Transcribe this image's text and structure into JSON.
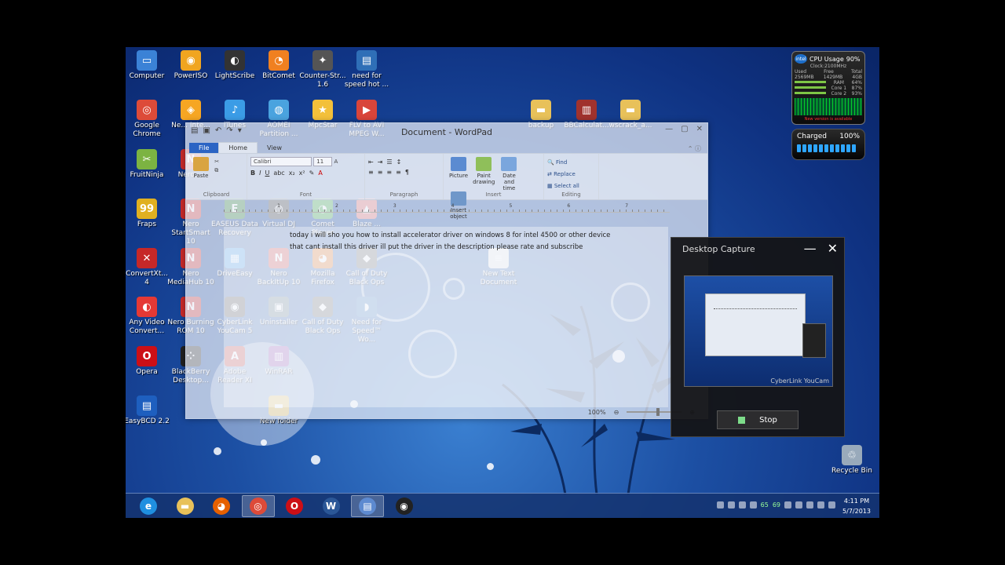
{
  "desktop_icons": [
    {
      "label": "Computer",
      "color": "#3b82d6",
      "glyph": "▭"
    },
    {
      "label": "PowerISO",
      "color": "#f0a520",
      "glyph": "◉"
    },
    {
      "label": "LightScribe",
      "color": "#333333",
      "glyph": "◐"
    },
    {
      "label": "BitComet",
      "color": "#f08020",
      "glyph": "◔"
    },
    {
      "label": "Counter-Str... 1.6",
      "color": "#555555",
      "glyph": "✦"
    },
    {
      "label": "need for speed hot ...",
      "color": "#2f6fb7",
      "glyph": "▤"
    },
    {
      "label": "Google Chrome",
      "color": "#dd4b39",
      "glyph": "◎"
    },
    {
      "label": "Ne... Inte...",
      "color": "#f6a623",
      "glyph": "◈"
    },
    {
      "label": "iTunes",
      "color": "#3b9ce6",
      "glyph": "♪"
    },
    {
      "label": "AOMEI Partition ...",
      "color": "#4aa3df",
      "glyph": "◍"
    },
    {
      "label": "MpcStar",
      "color": "#f3c03a",
      "glyph": "★"
    },
    {
      "label": "FLV to AVI MPEG W...",
      "color": "#d9453a",
      "glyph": "▶"
    },
    {
      "label": "FruitNinja",
      "color": "#7cb342",
      "glyph": "✂"
    },
    {
      "label": "Nero ...",
      "color": "#cc2b2b",
      "glyph": "N"
    },
    {
      "label": "Fraps",
      "color": "#e0b020",
      "glyph": "99"
    },
    {
      "label": "Nero StartSmart 10",
      "color": "#cc2b2b",
      "glyph": "N"
    },
    {
      "label": "EASEUS Data Recovery",
      "color": "#2e7d32",
      "glyph": "E"
    },
    {
      "label": "Virtual DJ",
      "color": "#444444",
      "glyph": "◍"
    },
    {
      "label": "Comet Player",
      "color": "#4caf50",
      "glyph": "◔"
    },
    {
      "label": "Blaze ...",
      "color": "#e57373",
      "glyph": "▲"
    },
    {
      "label": "ConvertXt... 4",
      "color": "#c62828",
      "glyph": "✕"
    },
    {
      "label": "Nero MediaHub 10",
      "color": "#cc2b2b",
      "glyph": "N"
    },
    {
      "label": "DriveEasy",
      "color": "#1e88e5",
      "glyph": "▦"
    },
    {
      "label": "Nero BackItUp 10",
      "color": "#cc2b2b",
      "glyph": "N"
    },
    {
      "label": "Mozilla Firefox",
      "color": "#e66000",
      "glyph": "◕"
    },
    {
      "label": "Call of Duty Black Ops",
      "color": "#555555",
      "glyph": "◆"
    },
    {
      "label": "New Text Document",
      "color": "#eeeeee",
      "glyph": "≡"
    },
    {
      "label": "Any Video Convert...",
      "color": "#e53935",
      "glyph": "◐"
    },
    {
      "label": "Nero Burning ROM 10",
      "color": "#cc2b2b",
      "glyph": "N"
    },
    {
      "label": "CyberLink YouCam 5",
      "color": "#333333",
      "glyph": "◉"
    },
    {
      "label": "Uninstaller",
      "color": "#546e7a",
      "glyph": "▣"
    },
    {
      "label": "Call of Duty Black Ops",
      "color": "#555555",
      "glyph": "◆"
    },
    {
      "label": "Need for Speed™ Wo...",
      "color": "#2f6fb7",
      "glyph": "◗"
    },
    {
      "label": "Opera",
      "color": "#cc0f16",
      "glyph": "O"
    },
    {
      "label": "BlackBerry Desktop...",
      "color": "#222222",
      "glyph": "⁘"
    },
    {
      "label": "Adobe Reader XI",
      "color": "#c62828",
      "glyph": "A"
    },
    {
      "label": "WinRAR",
      "color": "#8d3ea8",
      "glyph": "▥"
    },
    {
      "label": "EasyBCD 2.2",
      "color": "#1e5fbf",
      "glyph": "▤"
    },
    {
      "label": "New folder",
      "color": "#e8c15a",
      "glyph": "▬"
    },
    {
      "label": "backup",
      "color": "#e8c15a",
      "glyph": "▬"
    },
    {
      "label": "BBCalculat...",
      "color": "#a0322d",
      "glyph": "▥"
    },
    {
      "label": "wscrack_a...",
      "color": "#e8c15a",
      "glyph": "▬"
    },
    {
      "label": "Recycle Bin",
      "color": "#9ab",
      "glyph": "♲"
    }
  ],
  "cpu_gadget": {
    "brand": "intel",
    "title": "CPU Usage",
    "usage": "90%",
    "clock": "Clock:2100MHz",
    "labels": [
      "Used",
      "Free",
      "Total"
    ],
    "values": [
      "2569MB",
      "1429MB",
      "4GB"
    ],
    "ram": "RAM",
    "ram_pct": "64%",
    "core1": "Core 1",
    "core1_pct": "87%",
    "core2": "Core 2",
    "core2_pct": "93%",
    "note": "New version is available"
  },
  "battery_gadget": {
    "status": "Charged",
    "percent": "100%"
  },
  "wordpad": {
    "title": "Document - WordPad",
    "tabs": {
      "file": "File",
      "home": "Home",
      "view": "View"
    },
    "clipboard": {
      "paste": "Paste",
      "label": "Clipboard"
    },
    "font": {
      "name": "Calibri",
      "size": "11",
      "label": "Font"
    },
    "paragraph": {
      "label": "Paragraph"
    },
    "insert": {
      "picture": "Picture",
      "paint": "Paint drawing",
      "datetime": "Date and time",
      "object": "Insert object",
      "label": "Insert"
    },
    "editing": {
      "find": "Find",
      "replace": "Replace",
      "select_all": "Select all",
      "label": "Editing"
    },
    "ruler": [
      "1",
      "2",
      "3",
      "4",
      "5",
      "6",
      "7"
    ],
    "text_line1": "today i will sho you how to install accelerator driver on windows 8 for intel 4500  or other device",
    "text_line2": "that cant install this driver ill put the driver in the description please rate and subscribe",
    "zoom": "100%"
  },
  "capture": {
    "title": "Desktop Capture",
    "brand": "CyberLink YouCam",
    "stop": "Stop"
  },
  "taskbar": {
    "apps": [
      {
        "name": "internet-explorer",
        "glyph": "e",
        "color": "#1f8fe0"
      },
      {
        "name": "file-explorer",
        "glyph": "▬",
        "color": "#e8c15a"
      },
      {
        "name": "firefox",
        "glyph": "◕",
        "color": "#e66000"
      },
      {
        "name": "chrome",
        "glyph": "◎",
        "color": "#dd4b39"
      },
      {
        "name": "opera",
        "glyph": "O",
        "color": "#cc0f16"
      },
      {
        "name": "word",
        "glyph": "W",
        "color": "#2b5797"
      },
      {
        "name": "wordpad",
        "glyph": "▤",
        "color": "#5d8ad0"
      },
      {
        "name": "youcam",
        "glyph": "◉",
        "color": "#222222"
      }
    ],
    "tray_nums": [
      "65",
      "69"
    ],
    "time": "4:11 PM",
    "date": "5/7/2013"
  }
}
